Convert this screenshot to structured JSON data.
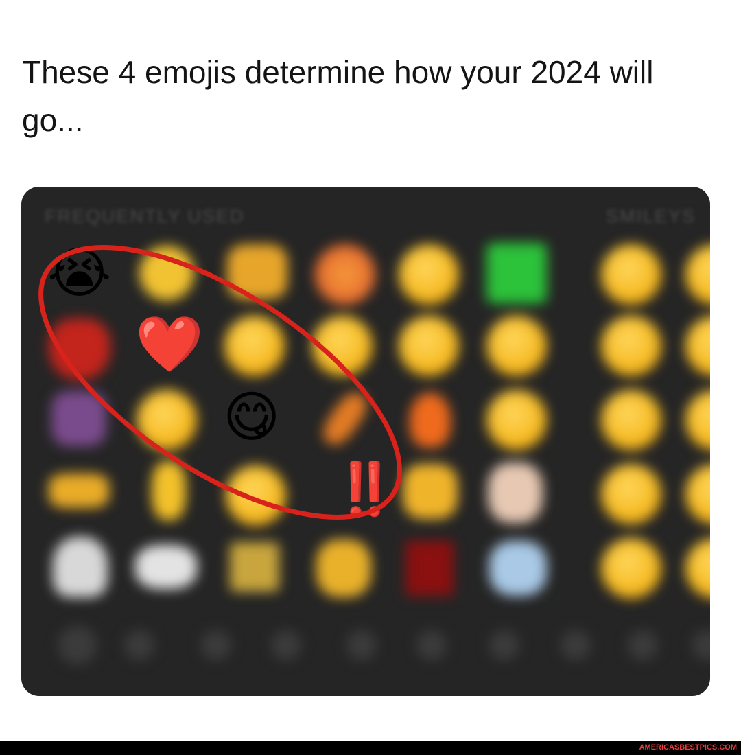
{
  "caption": "These 4 emojis determine how your 2024 will go...",
  "board": {
    "section_left": "FREQUENTLY USED",
    "section_right": "SMILEYS",
    "highlighted_emojis": [
      "😭",
      "❤️",
      "😋",
      "‼️"
    ]
  },
  "watermark": "AMERICASBESTPICS.COM",
  "colors": {
    "board_bg": "#252525",
    "highlight_ring": "#d8231c"
  }
}
